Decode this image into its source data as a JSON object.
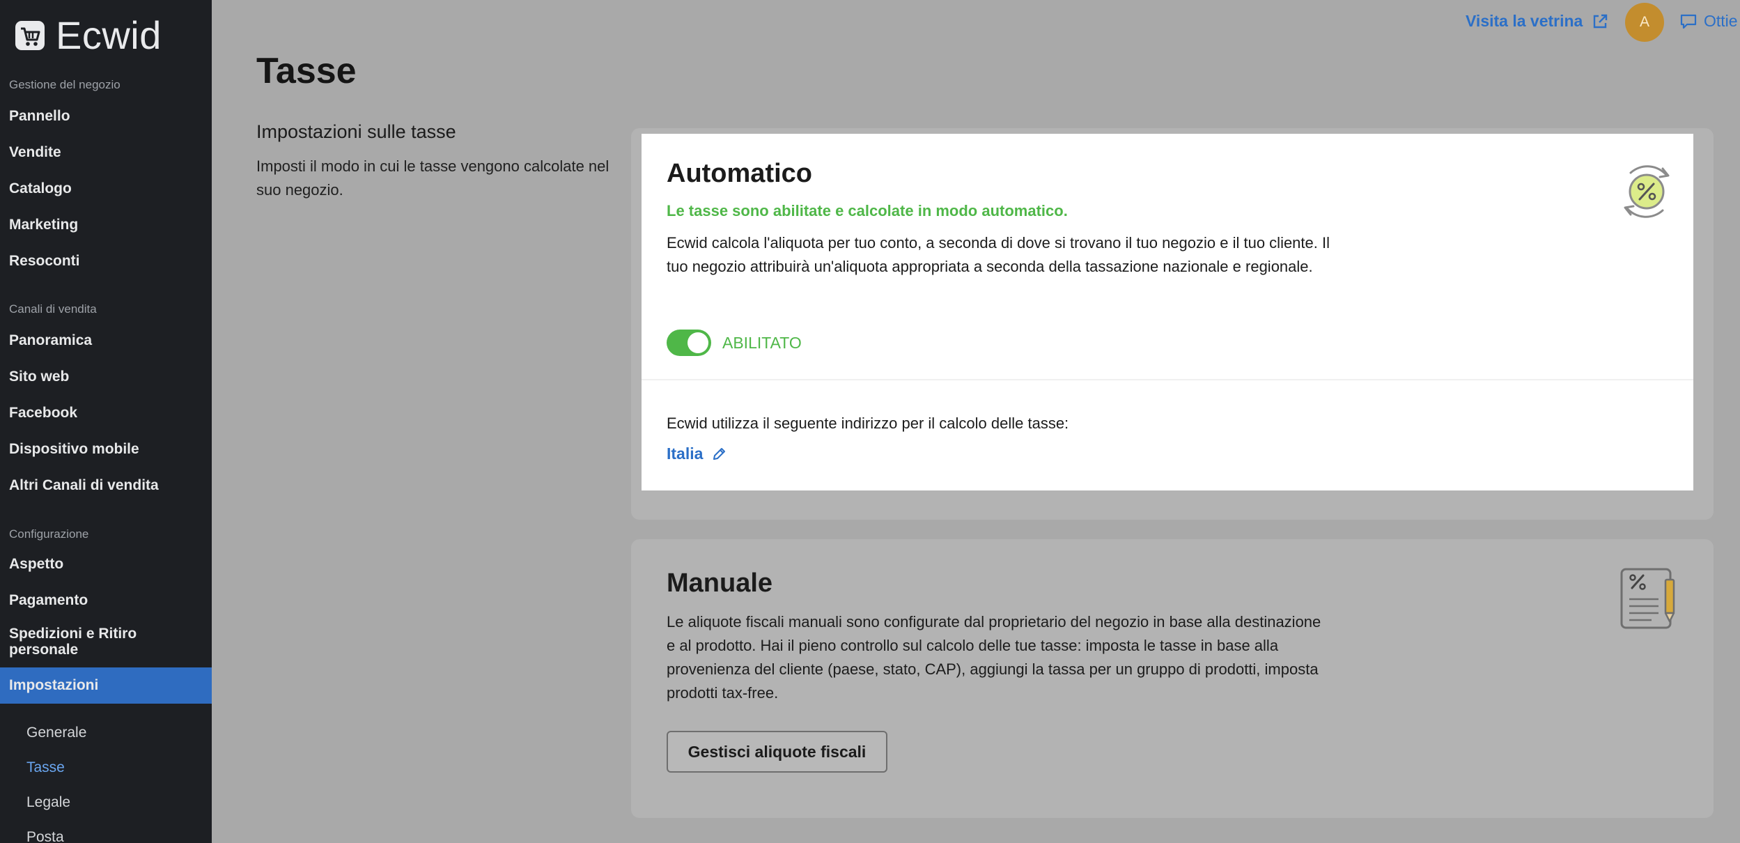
{
  "brand": {
    "name": "Ecwid",
    "icon": "shopping-cart-icon"
  },
  "sidebar": {
    "sections": [
      {
        "title": "Gestione del negozio",
        "items": [
          "Pannello",
          "Vendite",
          "Catalogo",
          "Marketing",
          "Resoconti"
        ]
      },
      {
        "title": "Canali di vendita",
        "items": [
          "Panoramica",
          "Sito web",
          "Facebook",
          "Dispositivo mobile",
          "Altri Canali di vendita"
        ]
      },
      {
        "title": "Configurazione",
        "items": [
          "Aspetto",
          "Pagamento",
          "Spedizioni e Ritiro personale",
          "Impostazioni"
        ]
      }
    ],
    "active_item": "Impostazioni",
    "sub_items": [
      "Generale",
      "Tasse",
      "Legale",
      "Posta"
    ],
    "current_sub_item": "Tasse"
  },
  "topbar": {
    "visit_store_label": "Visita la vetrina",
    "avatar_initial": "A",
    "chat_label": "Ottie"
  },
  "page": {
    "title": "Tasse",
    "settings_title": "Impostazioni sulle tasse",
    "settings_desc": "Imposti il modo in cui le tasse vengono calcolate nel suo negozio."
  },
  "automatic": {
    "title": "Automatico",
    "status": "Le tasse sono abilitate e calcolate in modo automatico.",
    "description": "Ecwid calcola l'aliquota per tuo conto, a seconda di dove si trovano il tuo negozio e il tuo cliente. Il tuo negozio attribuirà un'aliquota appropriata a seconda della tassazione nazionale e regionale.",
    "toggle_label": "ABILITATO",
    "toggle_on": true,
    "address_label": "Ecwid utilizza il seguente indirizzo per il calcolo delle tasse:",
    "address_value": "Italia",
    "icon": "percent-refresh-icon"
  },
  "manual": {
    "title": "Manuale",
    "description": "Le aliquote fiscali manuali sono configurate dal proprietario del negozio in base alla destinazione e al prodotto. Hai il pieno controllo sul calcolo delle tue tasse: imposta le tasse in base alla provenienza del cliente (paese, stato, CAP), aggiungi la tassa per un gruppo di prodotti, imposta prodotti tax-free.",
    "button_label": "Gestisci aliquote fiscali",
    "icon": "tax-document-icon"
  },
  "colors": {
    "accent_blue": "#2b6fc7",
    "success_green": "#4fb748",
    "sidebar_bg": "#1d1f23",
    "active_nav_bg": "#2f6cc0"
  }
}
